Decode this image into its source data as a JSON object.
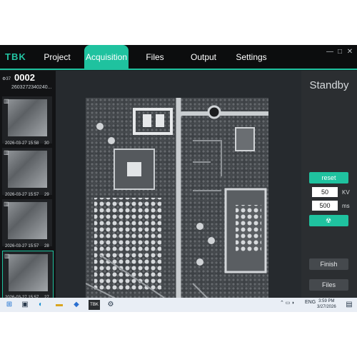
{
  "app": {
    "logo": "TBK"
  },
  "tabs": [
    {
      "label": "Project",
      "active": false
    },
    {
      "label": "Acquisition",
      "active": true
    },
    {
      "label": "Files",
      "active": false
    },
    {
      "label": "Output",
      "active": false
    },
    {
      "label": "Settings",
      "active": false
    }
  ],
  "window_controls": {
    "minimize": "—",
    "maximize": "□",
    "close": "✕"
  },
  "sample": {
    "badge": "⚙37",
    "number": "0002",
    "code": "2603272340240..."
  },
  "thumbnails": [
    {
      "date": "2026-03-27 15:58",
      "num": "30"
    },
    {
      "date": "2026-03-27 15:57",
      "num": "29"
    },
    {
      "date": "2026-03-27 15:57",
      "num": "28"
    },
    {
      "date": "2026-03-27 15:57",
      "num": "27"
    }
  ],
  "right": {
    "status": "Standby",
    "reset_label": "reset",
    "kv_value": "50",
    "kv_unit": "KV",
    "ms_value": "500",
    "ms_unit": "ms",
    "xray_icon": "radiation-icon",
    "finish_label": "Finish",
    "files_label": "Files"
  },
  "taskbar": {
    "lang": "ENG",
    "time": "3:59 PM",
    "date": "3/27/2026"
  },
  "colors": {
    "accent": "#1fc29f",
    "background": "#1c1e21"
  }
}
